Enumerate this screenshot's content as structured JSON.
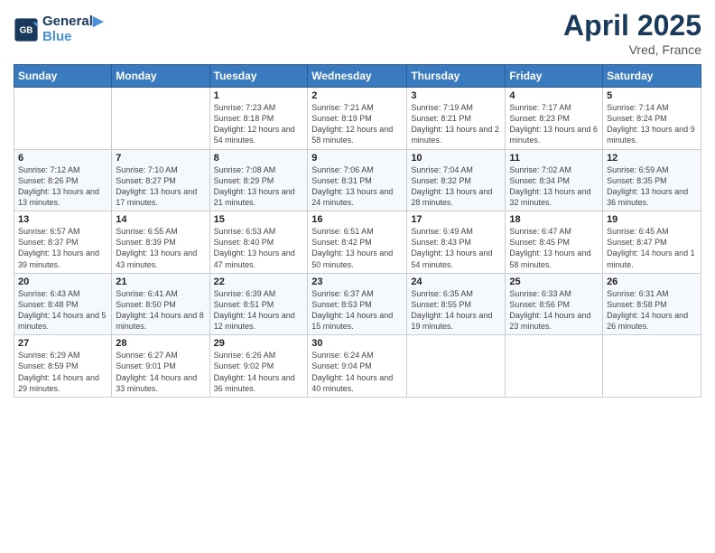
{
  "header": {
    "logo_line1": "General",
    "logo_line2": "Blue",
    "title": "April 2025",
    "subtitle": "Vred, France"
  },
  "weekdays": [
    "Sunday",
    "Monday",
    "Tuesday",
    "Wednesday",
    "Thursday",
    "Friday",
    "Saturday"
  ],
  "weeks": [
    [
      {
        "day": "",
        "info": ""
      },
      {
        "day": "",
        "info": ""
      },
      {
        "day": "1",
        "info": "Sunrise: 7:23 AM\nSunset: 8:18 PM\nDaylight: 12 hours and 54 minutes."
      },
      {
        "day": "2",
        "info": "Sunrise: 7:21 AM\nSunset: 8:19 PM\nDaylight: 12 hours and 58 minutes."
      },
      {
        "day": "3",
        "info": "Sunrise: 7:19 AM\nSunset: 8:21 PM\nDaylight: 13 hours and 2 minutes."
      },
      {
        "day": "4",
        "info": "Sunrise: 7:17 AM\nSunset: 8:23 PM\nDaylight: 13 hours and 6 minutes."
      },
      {
        "day": "5",
        "info": "Sunrise: 7:14 AM\nSunset: 8:24 PM\nDaylight: 13 hours and 9 minutes."
      }
    ],
    [
      {
        "day": "6",
        "info": "Sunrise: 7:12 AM\nSunset: 8:26 PM\nDaylight: 13 hours and 13 minutes."
      },
      {
        "day": "7",
        "info": "Sunrise: 7:10 AM\nSunset: 8:27 PM\nDaylight: 13 hours and 17 minutes."
      },
      {
        "day": "8",
        "info": "Sunrise: 7:08 AM\nSunset: 8:29 PM\nDaylight: 13 hours and 21 minutes."
      },
      {
        "day": "9",
        "info": "Sunrise: 7:06 AM\nSunset: 8:31 PM\nDaylight: 13 hours and 24 minutes."
      },
      {
        "day": "10",
        "info": "Sunrise: 7:04 AM\nSunset: 8:32 PM\nDaylight: 13 hours and 28 minutes."
      },
      {
        "day": "11",
        "info": "Sunrise: 7:02 AM\nSunset: 8:34 PM\nDaylight: 13 hours and 32 minutes."
      },
      {
        "day": "12",
        "info": "Sunrise: 6:59 AM\nSunset: 8:35 PM\nDaylight: 13 hours and 36 minutes."
      }
    ],
    [
      {
        "day": "13",
        "info": "Sunrise: 6:57 AM\nSunset: 8:37 PM\nDaylight: 13 hours and 39 minutes."
      },
      {
        "day": "14",
        "info": "Sunrise: 6:55 AM\nSunset: 8:39 PM\nDaylight: 13 hours and 43 minutes."
      },
      {
        "day": "15",
        "info": "Sunrise: 6:53 AM\nSunset: 8:40 PM\nDaylight: 13 hours and 47 minutes."
      },
      {
        "day": "16",
        "info": "Sunrise: 6:51 AM\nSunset: 8:42 PM\nDaylight: 13 hours and 50 minutes."
      },
      {
        "day": "17",
        "info": "Sunrise: 6:49 AM\nSunset: 8:43 PM\nDaylight: 13 hours and 54 minutes."
      },
      {
        "day": "18",
        "info": "Sunrise: 6:47 AM\nSunset: 8:45 PM\nDaylight: 13 hours and 58 minutes."
      },
      {
        "day": "19",
        "info": "Sunrise: 6:45 AM\nSunset: 8:47 PM\nDaylight: 14 hours and 1 minute."
      }
    ],
    [
      {
        "day": "20",
        "info": "Sunrise: 6:43 AM\nSunset: 8:48 PM\nDaylight: 14 hours and 5 minutes."
      },
      {
        "day": "21",
        "info": "Sunrise: 6:41 AM\nSunset: 8:50 PM\nDaylight: 14 hours and 8 minutes."
      },
      {
        "day": "22",
        "info": "Sunrise: 6:39 AM\nSunset: 8:51 PM\nDaylight: 14 hours and 12 minutes."
      },
      {
        "day": "23",
        "info": "Sunrise: 6:37 AM\nSunset: 8:53 PM\nDaylight: 14 hours and 15 minutes."
      },
      {
        "day": "24",
        "info": "Sunrise: 6:35 AM\nSunset: 8:55 PM\nDaylight: 14 hours and 19 minutes."
      },
      {
        "day": "25",
        "info": "Sunrise: 6:33 AM\nSunset: 8:56 PM\nDaylight: 14 hours and 23 minutes."
      },
      {
        "day": "26",
        "info": "Sunrise: 6:31 AM\nSunset: 8:58 PM\nDaylight: 14 hours and 26 minutes."
      }
    ],
    [
      {
        "day": "27",
        "info": "Sunrise: 6:29 AM\nSunset: 8:59 PM\nDaylight: 14 hours and 29 minutes."
      },
      {
        "day": "28",
        "info": "Sunrise: 6:27 AM\nSunset: 9:01 PM\nDaylight: 14 hours and 33 minutes."
      },
      {
        "day": "29",
        "info": "Sunrise: 6:26 AM\nSunset: 9:02 PM\nDaylight: 14 hours and 36 minutes."
      },
      {
        "day": "30",
        "info": "Sunrise: 6:24 AM\nSunset: 9:04 PM\nDaylight: 14 hours and 40 minutes."
      },
      {
        "day": "",
        "info": ""
      },
      {
        "day": "",
        "info": ""
      },
      {
        "day": "",
        "info": ""
      }
    ]
  ]
}
